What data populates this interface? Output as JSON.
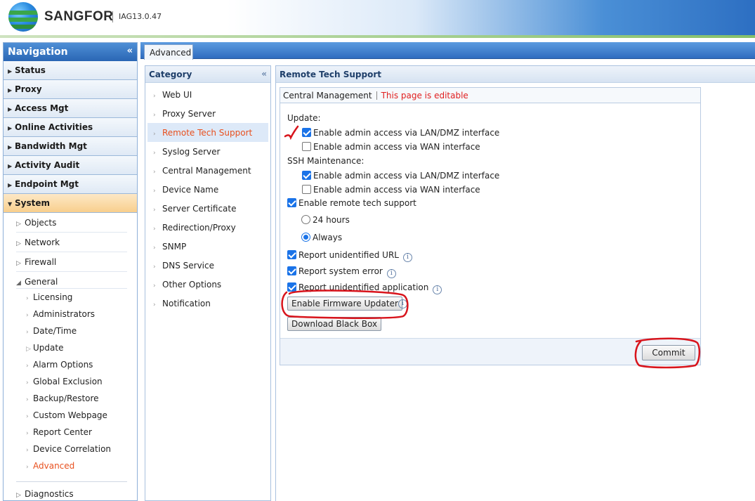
{
  "header": {
    "brand": "SANGFOR",
    "version": "IAG13.0.47"
  },
  "nav": {
    "title": "Navigation",
    "groups": [
      "Status",
      "Proxy",
      "Access Mgt",
      "Online Activities",
      "Bandwidth Mgt",
      "Activity Audit",
      "Endpoint Mgt",
      "System"
    ],
    "system_children": [
      "Objects",
      "Network",
      "Firewall",
      "General"
    ],
    "general_children": [
      "Licensing",
      "Administrators",
      "Date/Time",
      "Update",
      "Alarm Options",
      "Global Exclusion",
      "Backup/Restore",
      "Custom Webpage",
      "Report Center",
      "Device Correlation",
      "Advanced"
    ],
    "diagnostics": "Diagnostics"
  },
  "tabs": {
    "active": "Advanced"
  },
  "category": {
    "title": "Category",
    "items": [
      "Web UI",
      "Proxy Server",
      "Remote Tech Support",
      "Syslog Server",
      "Central Management",
      "Device Name",
      "Server Certificate",
      "Redirection/Proxy",
      "SNMP",
      "DNS Service",
      "Other Options",
      "Notification"
    ],
    "selected": "Remote Tech Support"
  },
  "main": {
    "title": "Remote Tech Support",
    "head_label": "Central Management",
    "head_status": "This page is editable",
    "update_label": "Update:",
    "update_lan": "Enable admin access via LAN/DMZ interface",
    "update_wan": "Enable admin access via WAN interface",
    "ssh_label": "SSH Maintenance:",
    "ssh_lan": "Enable admin access via LAN/DMZ interface",
    "ssh_wan": "Enable admin access via WAN interface",
    "remote_support": "Enable remote tech support",
    "radio_24h": "24 hours",
    "radio_always": "Always",
    "report_url": "Report unidentified URL",
    "report_error": "Report system error",
    "report_app": "Report unidentified application",
    "firmware_btn": "Enable Firmware Updater",
    "blackbox_btn": "Download Black Box",
    "commit_btn": "Commit"
  },
  "colors": {
    "accent": "#2a66b4",
    "editable": "#e02020",
    "selected": "#e8501e",
    "annotation": "#d8141c"
  }
}
